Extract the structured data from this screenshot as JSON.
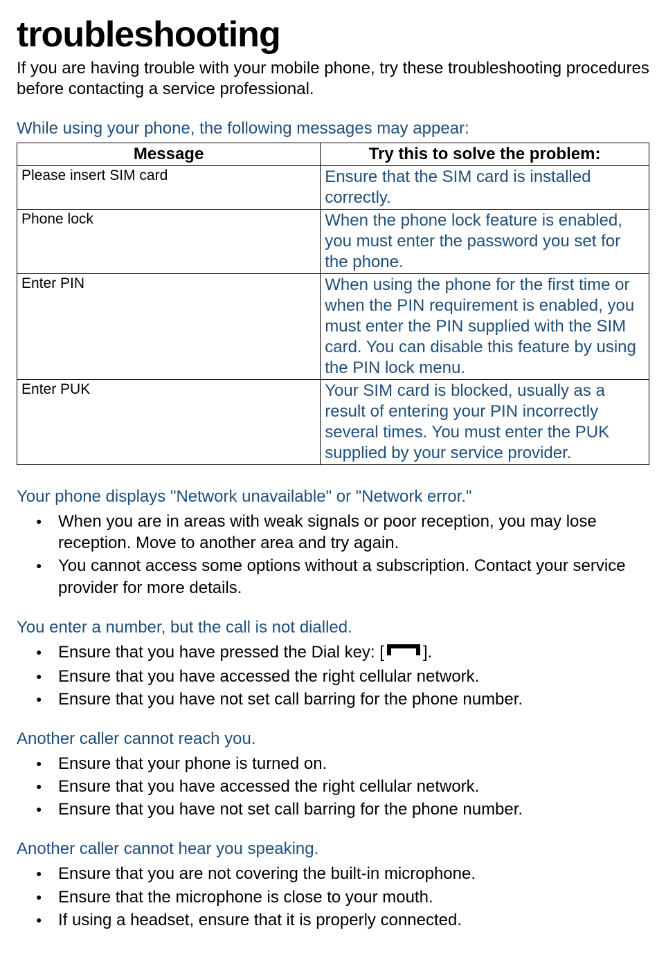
{
  "title": "troubleshooting",
  "intro": "If you are having trouble with your mobile phone, try these troubleshooting procedures before contacting a service professional.",
  "table_section": {
    "heading": "While using your phone, the following messages may appear:",
    "headers": {
      "col1": "Message",
      "col2": "Try this to solve the problem:"
    },
    "rows": [
      {
        "msg": "Please insert SIM card",
        "sol": "Ensure that the SIM card is installed correctly."
      },
      {
        "msg": "Phone lock",
        "sol": "When the phone lock feature is enabled, you must enter the password you set for the phone."
      },
      {
        "msg": "Enter PIN",
        "sol": "When using the phone for the first time or when the PIN requirement is enabled, you must enter the PIN supplied with the SIM card. You can disable this feature by using the PIN lock   menu."
      },
      {
        "msg": "Enter PUK",
        "sol": "Your SIM card is blocked, usually as a result of entering your PIN incorrectly several times. You must enter the PUK supplied by your service provider."
      }
    ]
  },
  "sections": {
    "network": {
      "heading": "Your phone displays \"Network unavailable\" or \"Network error.\"",
      "items": [
        "When you are in areas with weak signals or poor reception, you may lose reception. Move to another area and try again.",
        "You cannot access some options without a subscription. Contact your service provider for more details."
      ]
    },
    "notdialled": {
      "heading": "You enter a number, but the call is not dialled.",
      "items_pre": "Ensure that you have pressed the Dial key: [",
      "items_post": "].",
      "items_rest": [
        "Ensure that you have accessed the right cellular network.",
        "Ensure that you have not set call barring for the phone number."
      ]
    },
    "cannotreach": {
      "heading": "Another caller cannot reach you.",
      "items": [
        "Ensure that your phone is turned on.",
        "Ensure that you have accessed the right cellular network.",
        "Ensure that you have not set call barring for the phone number."
      ]
    },
    "cannothear": {
      "heading": "Another caller cannot hear you speaking.",
      "items": [
        "Ensure that you are not covering the built-in microphone.",
        "Ensure that the microphone is close to your mouth.",
        "If using a headset, ensure that it is properly connected."
      ]
    }
  }
}
